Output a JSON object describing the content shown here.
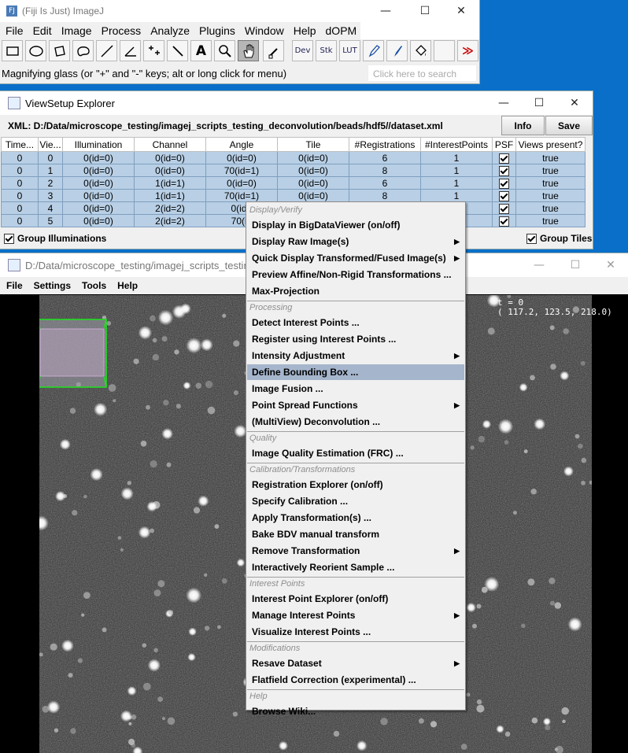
{
  "imagej": {
    "title": "(Fiji Is Just) ImageJ",
    "menu": [
      "File",
      "Edit",
      "Image",
      "Process",
      "Analyze",
      "Plugins",
      "Window",
      "Help",
      "dOPM"
    ],
    "tools": [
      "rectangle-tool",
      "oval-tool",
      "polygon-tool",
      "freehand-tool",
      "line-tool",
      "angle-tool",
      "multipoint-tool",
      "wand-tool",
      "text-tool",
      "magnifier-tool",
      "hand-tool",
      "color-picker-tool",
      "Dev",
      "Stk",
      "LUT",
      "pencil-tool",
      "paintbrush-tool",
      "flood-fill-tool",
      "blank-tool",
      "more-tools"
    ],
    "status": "Magnifying glass (or \"+\" and \"-\" keys; alt or long click for menu)",
    "search_placeholder": "Click here to search"
  },
  "vse": {
    "title": "ViewSetup Explorer",
    "xml_path": "XML: D:/Data/microscope_testing/imagej_scripts_testing_deconvolution/beads/hdf5//dataset.xml",
    "info_label": "Info",
    "save_label": "Save",
    "columns": [
      "Time...",
      "Vie...",
      "Illumination",
      "Channel",
      "Angle",
      "Tile",
      "#Registrations",
      "#InterestPoints",
      "PSF",
      "Views present?"
    ],
    "rows": [
      [
        "0",
        "0",
        "0(id=0)",
        "0(id=0)",
        "0(id=0)",
        "0(id=0)",
        "6",
        "1",
        "checked",
        "true"
      ],
      [
        "0",
        "1",
        "0(id=0)",
        "0(id=0)",
        "70(id=1)",
        "0(id=0)",
        "8",
        "1",
        "checked",
        "true"
      ],
      [
        "0",
        "2",
        "0(id=0)",
        "1(id=1)",
        "0(id=0)",
        "0(id=0)",
        "6",
        "1",
        "checked",
        "true"
      ],
      [
        "0",
        "3",
        "0(id=0)",
        "1(id=1)",
        "70(id=1)",
        "0(id=0)",
        "8",
        "1",
        "checked",
        "true"
      ],
      [
        "0",
        "4",
        "0(id=0)",
        "2(id=2)",
        "0(id=",
        "",
        "",
        "",
        "checked",
        "true"
      ],
      [
        "0",
        "5",
        "0(id=0)",
        "2(id=2)",
        "70(id",
        "",
        "",
        "",
        "checked",
        "true"
      ]
    ],
    "group_illuminations": "Group Illuminations",
    "group_tiles": "Group Tiles"
  },
  "bdv": {
    "title": "D:/Data/microscope_testing/imagej_scripts_testing_d",
    "menu": [
      "File",
      "Settings",
      "Tools",
      "Help"
    ],
    "readout_t": "t = 0",
    "readout_coords": "( 117.2, 123.5, 218.0)"
  },
  "context_menu": {
    "sections": [
      {
        "header": "Display/Verify",
        "items": [
          {
            "label": "Display in BigDataViewer (on/off)",
            "submenu": false
          },
          {
            "label": "Display Raw Image(s)",
            "submenu": true
          },
          {
            "label": "Quick Display Transformed/Fused Image(s)",
            "submenu": true
          },
          {
            "label": "Preview Affine/Non-Rigid Transformations ...",
            "submenu": false
          },
          {
            "label": "Max-Projection",
            "submenu": false
          }
        ]
      },
      {
        "header": "Processing",
        "items": [
          {
            "label": "Detect Interest Points ...",
            "submenu": false
          },
          {
            "label": "Register using Interest Points ...",
            "submenu": false
          },
          {
            "label": "Intensity Adjustment",
            "submenu": true
          },
          {
            "label": "Define Bounding Box ...",
            "submenu": false,
            "highlighted": true
          },
          {
            "label": "Image Fusion ...",
            "submenu": false
          },
          {
            "label": "Point Spread Functions",
            "submenu": true
          },
          {
            "label": "(MultiView) Deconvolution ...",
            "submenu": false
          }
        ]
      },
      {
        "header": "Quality",
        "items": [
          {
            "label": "Image Quality Estimation (FRC) ...",
            "submenu": false
          }
        ]
      },
      {
        "header": "Calibration/Transformations",
        "items": [
          {
            "label": "Registration Explorer (on/off)",
            "submenu": false
          },
          {
            "label": "Specify Calibration ...",
            "submenu": false
          },
          {
            "label": "Apply Transformation(s) ...",
            "submenu": false
          },
          {
            "label": "Bake BDV manual transform",
            "submenu": false
          },
          {
            "label": "Remove Transformation",
            "submenu": true
          },
          {
            "label": "Interactively Reorient Sample ...",
            "submenu": false
          }
        ]
      },
      {
        "header": "Interest Points",
        "items": [
          {
            "label": "Interest Point Explorer (on/off)",
            "submenu": false
          },
          {
            "label": "Manage Interest Points",
            "submenu": true
          },
          {
            "label": "Visualize Interest Points ...",
            "submenu": false
          }
        ]
      },
      {
        "header": "Modifications",
        "items": [
          {
            "label": "Resave Dataset",
            "submenu": true
          },
          {
            "label": "Flatfield Correction (experimental) ...",
            "submenu": false
          }
        ]
      },
      {
        "header": "Help",
        "items": [
          {
            "label": "Browse Wiki...",
            "submenu": false
          }
        ]
      }
    ]
  },
  "colors": {
    "desktop": "#0a6fc9",
    "selection_row": "#b8cfe5",
    "menu_highlight": "#a5b5cc",
    "bbox": "#22dd22"
  }
}
